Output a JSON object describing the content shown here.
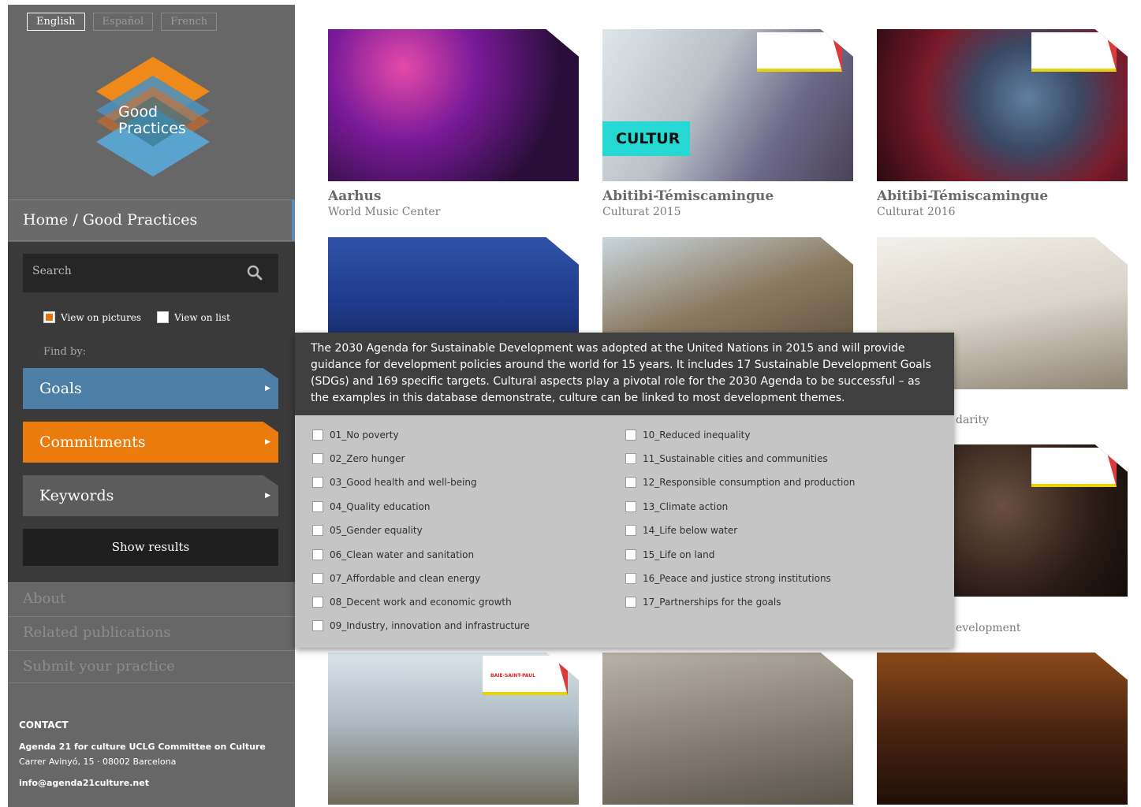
{
  "languages": [
    {
      "label": "English",
      "active": true
    },
    {
      "label": "Español",
      "active": false
    },
    {
      "label": "French",
      "active": false
    }
  ],
  "logo": {
    "line1": "Good",
    "line2": "Practices"
  },
  "breadcrumb": "Home / Good Practices",
  "search": {
    "placeholder": "Search"
  },
  "view_options": {
    "pictures": "View on pictures",
    "list": "View on list",
    "selected": "pictures"
  },
  "find_by": "Find by:",
  "filters": {
    "goals": "Goals",
    "commitments": "Commitments",
    "keywords": "Keywords"
  },
  "show_results": "Show results",
  "side_links": {
    "about": "About",
    "publications": "Related publications",
    "submit": "Submit your practice"
  },
  "contact": {
    "heading": "CONTACT",
    "org": "Agenda 21 for culture UCLG Committee on Culture",
    "address": "Carrer Avinyó, 15 · 08002 Barcelona",
    "email": "info@agenda21culture.net"
  },
  "gallery": [
    {
      "title": "Aarhus",
      "subtitle": "World Music Center"
    },
    {
      "title": "Abitibi-Témiscamingue",
      "subtitle": "Culturat 2015"
    },
    {
      "title": "Abitibi-Témiscamingue",
      "subtitle": "Culturat 2016"
    }
  ],
  "image_text": {
    "cultur_sign": "CULTUR",
    "badge_label": "BAIE-SAINT-PAUL"
  },
  "partial_captions": {
    "row2": "darity",
    "row3": "evelopment"
  },
  "goals_popup": {
    "description": "The 2030 Agenda for Sustainable Development was adopted at the United Nations in 2015 and will provide guidance for development policies around the world for 15 years. It includes 17 Sustainable Development Goals (SDGs) and 169 specific targets. Cultural aspects play a pivotal role for the 2030 Agenda to be successful – as the examples in this database demonstrate, culture can be linked to most development themes.",
    "left_goals": [
      "01_No poverty",
      "02_Zero hunger",
      "03_Good health and well-being",
      "04_Quality education",
      "05_Gender equality",
      "06_Clean water and sanitation",
      "07_Affordable and clean energy",
      "08_Decent work and economic growth",
      "09_Industry, innovation and infrastructure"
    ],
    "right_goals": [
      "10_Reduced inequality",
      "11_Sustainable cities and communities",
      "12_Responsible consumption and production",
      "13_Climate action",
      "14_Life below water",
      "15_Life on land",
      "16_Peace and justice strong institutions",
      "17_Partnerships for the goals"
    ]
  },
  "colors": {
    "goals": "#4c7ea6",
    "commitments": "#ea7b0c",
    "keywords": "#5c5c5c",
    "accent": "#e8720c"
  }
}
